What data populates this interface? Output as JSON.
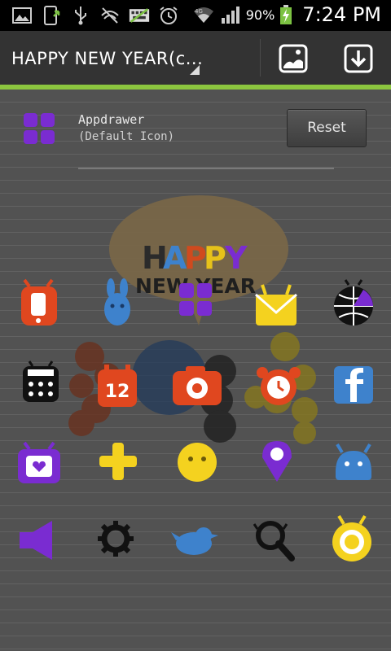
{
  "status_bar": {
    "battery_percent": "90%",
    "time": "7:24 PM",
    "icons": [
      "gallery-icon",
      "phone-download-icon",
      "usb-icon",
      "no-signal-icon",
      "keyboard-icon",
      "alarm-icon",
      "wifi-icon",
      "signal-icon",
      "battery-charging-icon"
    ]
  },
  "action_bar": {
    "title": "HAPPY NEW YEAR(c...",
    "buttons": [
      "wallpaper-icon",
      "download-icon"
    ]
  },
  "drawer": {
    "label": "Appdrawer",
    "sublabel": "(Default Icon)",
    "reset_label": "Reset"
  },
  "preview": {
    "banner_line1": [
      "H",
      "A",
      "P",
      "P",
      "Y"
    ],
    "banner_line2": "NEW YEAR",
    "calendar_day": "12"
  },
  "colors": {
    "accent_green": "#8cc63f",
    "icon_red": "#e0471f",
    "icon_blue": "#3e82cc",
    "icon_purple": "#7a2cd1",
    "icon_yellow": "#f4d21f",
    "icon_black": "#111111",
    "icon_brown": "#7a3a1c"
  }
}
